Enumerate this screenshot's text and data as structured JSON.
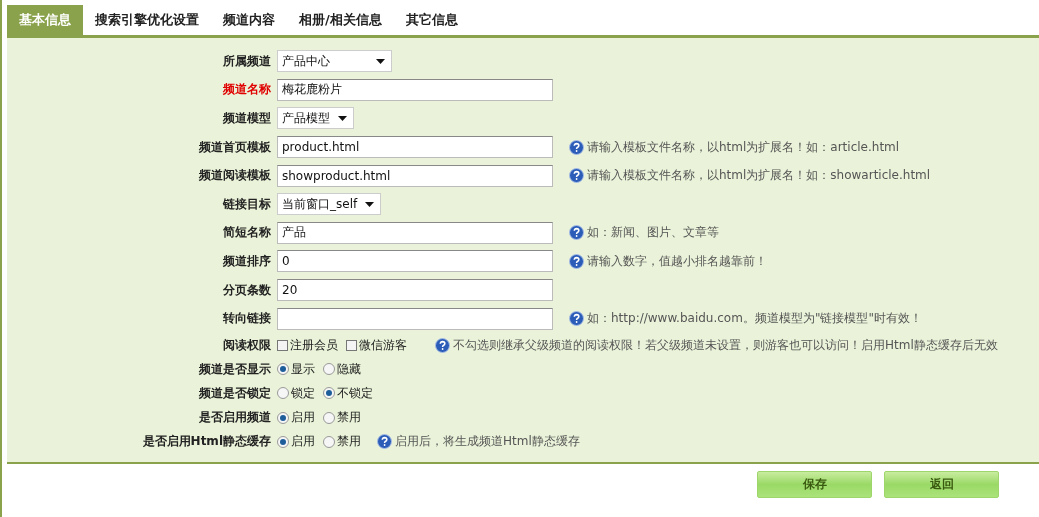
{
  "tabs": [
    {
      "label": "基本信息",
      "selected": true
    },
    {
      "label": "搜索引擎优化设置",
      "selected": false
    },
    {
      "label": "频道内容",
      "selected": false
    },
    {
      "label": "相册/相关信息",
      "selected": false
    },
    {
      "label": "其它信息",
      "selected": false
    }
  ],
  "fields": [
    {
      "kind": "select",
      "label": "所属频道",
      "required": false,
      "value": "产品中心"
    },
    {
      "kind": "text",
      "label": "频道名称",
      "required": true,
      "value": "梅花鹿粉片"
    },
    {
      "kind": "select",
      "label": "频道模型",
      "required": false,
      "value": "产品模型"
    },
    {
      "kind": "text",
      "label": "频道首页模板",
      "required": false,
      "value": "product.html",
      "hint": "请输入模板文件名称，以html为扩展名！如：article.html"
    },
    {
      "kind": "text",
      "label": "频道阅读模板",
      "required": false,
      "value": "showproduct.html",
      "hint": "请输入模板文件名称，以html为扩展名！如：showarticle.html"
    },
    {
      "kind": "select",
      "label": "链接目标",
      "required": false,
      "value": "当前窗口_self"
    },
    {
      "kind": "text",
      "label": "简短名称",
      "required": false,
      "value": "产品",
      "hint": "如：新闻、图片、文章等"
    },
    {
      "kind": "text",
      "label": "频道排序",
      "required": false,
      "value": "0",
      "hint": "请输入数字，值越小排名越靠前！"
    },
    {
      "kind": "text",
      "label": "分页条数",
      "required": false,
      "value": "20"
    },
    {
      "kind": "text",
      "label": "转向链接",
      "required": false,
      "hint": "如：http://www.baidu.com。频道模型为\"链接模型\"时有效！"
    },
    {
      "kind": "checkboxes",
      "label": "阅读权限",
      "required": false,
      "options": [
        {
          "label": "注册会员",
          "checked": false
        },
        {
          "label": "微信游客",
          "checked": false
        }
      ],
      "hint": "不勾选则继承父级频道的阅读权限！若父级频道未设置，则游客也可以访问！启用Html静态缓存后无效"
    },
    {
      "kind": "radios",
      "label": "频道是否显示",
      "required": false,
      "options": [
        {
          "label": "显示",
          "selected": true
        },
        {
          "label": "隐藏",
          "selected": false
        }
      ]
    },
    {
      "kind": "radios",
      "label": "频道是否锁定",
      "required": false,
      "options": [
        {
          "label": "锁定",
          "selected": false
        },
        {
          "label": "不锁定",
          "selected": true
        }
      ]
    },
    {
      "kind": "radios",
      "label": "是否启用频道",
      "required": false,
      "options": [
        {
          "label": "启用",
          "selected": true
        },
        {
          "label": "禁用",
          "selected": false
        }
      ]
    },
    {
      "kind": "radios",
      "label": "是否启用Html静态缓存",
      "required": false,
      "options": [
        {
          "label": "启用",
          "selected": true
        },
        {
          "label": "禁用",
          "selected": false
        }
      ],
      "hint": "启用后，将生成频道Html静态缓存"
    }
  ],
  "buttons": [
    "保存",
    "返回"
  ]
}
